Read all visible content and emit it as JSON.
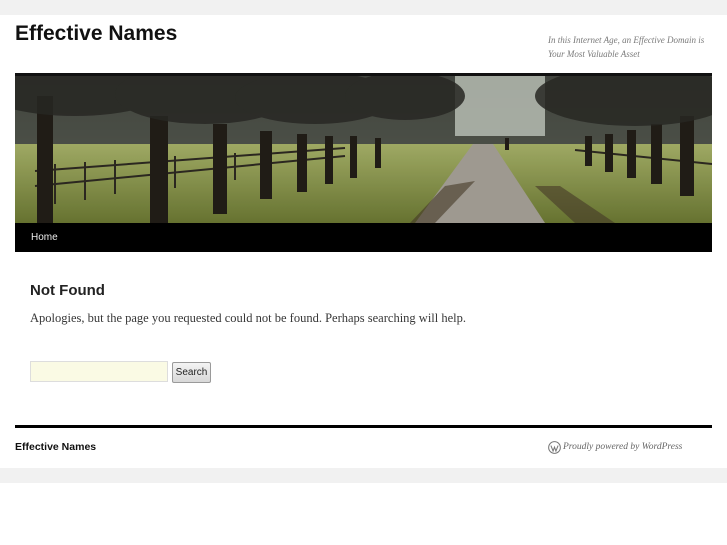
{
  "site": {
    "title": "Effective Names",
    "description": "In this Internet Age, an Effective Domain is Your Most Valuable Asset"
  },
  "nav": {
    "items": [
      {
        "label": "Home"
      }
    ]
  },
  "content": {
    "title": "Not Found",
    "message": "Apologies, but the page you requested could not be found. Perhaps searching will help.",
    "search": {
      "value": "",
      "button_label": "Search"
    }
  },
  "footer": {
    "site_name": "Effective Names",
    "powered_by": "Proudly powered by WordPress",
    "icon": "wordpress-icon"
  },
  "colors": {
    "nav_background": "#000000",
    "page_band": "#f1f1f1",
    "search_field": "#fafae4"
  }
}
